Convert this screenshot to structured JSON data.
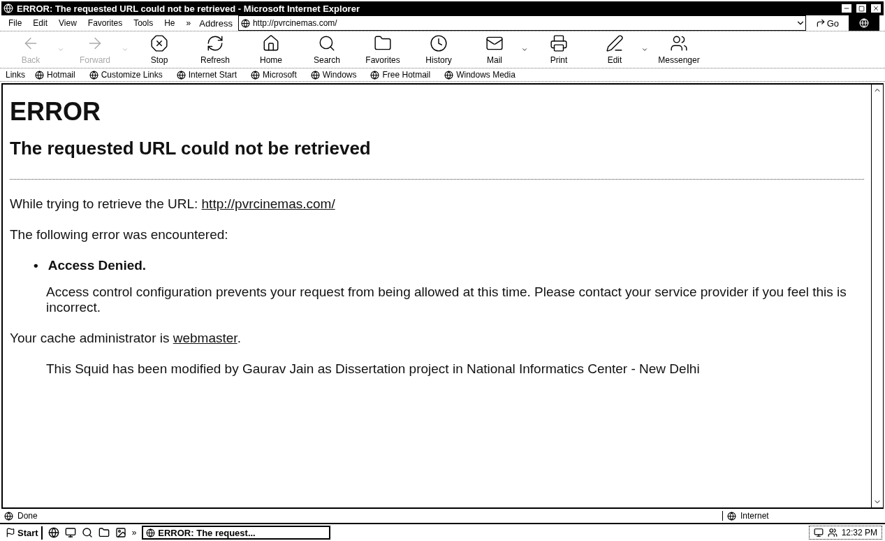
{
  "window": {
    "title": "ERROR: The requested URL could not be retrieved - Microsoft Internet Explorer"
  },
  "menu": [
    "File",
    "Edit",
    "View",
    "Favorites",
    "Tools",
    "He"
  ],
  "menu_overflow": "»",
  "address": {
    "label": "Address",
    "value": "http://pvrcinemas.com/",
    "go": "Go"
  },
  "toolbar": [
    {
      "label": "Back",
      "kind": "back",
      "disabled": true,
      "dropdown": true
    },
    {
      "label": "Forward",
      "kind": "forward",
      "disabled": true,
      "dropdown": true
    },
    {
      "label": "Stop",
      "kind": "stop",
      "disabled": false,
      "dropdown": false
    },
    {
      "label": "Refresh",
      "kind": "refresh",
      "disabled": false,
      "dropdown": false
    },
    {
      "label": "Home",
      "kind": "home",
      "disabled": false,
      "dropdown": false
    },
    {
      "label": "Search",
      "kind": "search",
      "disabled": false,
      "dropdown": false
    },
    {
      "label": "Favorites",
      "kind": "favorites",
      "disabled": false,
      "dropdown": false
    },
    {
      "label": "History",
      "kind": "history",
      "disabled": false,
      "dropdown": false
    },
    {
      "label": "Mail",
      "kind": "mail",
      "disabled": false,
      "dropdown": true
    },
    {
      "label": "Print",
      "kind": "print",
      "disabled": false,
      "dropdown": false
    },
    {
      "label": "Edit",
      "kind": "edit",
      "disabled": false,
      "dropdown": true
    },
    {
      "label": "Messenger",
      "kind": "messenger",
      "disabled": false,
      "dropdown": false
    }
  ],
  "links": {
    "label": "Links",
    "items": [
      "Hotmail",
      "Customize Links",
      "Internet Start",
      "Microsoft",
      "Windows",
      "Free Hotmail",
      "Windows Media"
    ]
  },
  "page": {
    "title": "ERROR",
    "subtitle": "The requested URL could not be retrieved",
    "url_line": {
      "text": "While trying to retrieve the URL: ",
      "link": "http://pvrcinemas.com/"
    },
    "encountered": "The following error was encountered:",
    "error_bullet": "•",
    "error_item": "Access Denied.",
    "error_detail": "Access control configuration prevents your request from being allowed at this time. Please contact your service provider if you feel this is incorrect.",
    "admin_line": {
      "text": "Your cache administrator is ",
      "link": "webmaster",
      "suffix": "."
    },
    "note": "This Squid has been modified by Gaurav Jain as Dissertation project in National Informatics Center - New Delhi"
  },
  "status_bar": {
    "text": "Done",
    "zone": "Internet"
  },
  "taskbar": {
    "start": "Start",
    "overflow": "»",
    "task": "ERROR: The request...",
    "time": "12:32 PM"
  }
}
